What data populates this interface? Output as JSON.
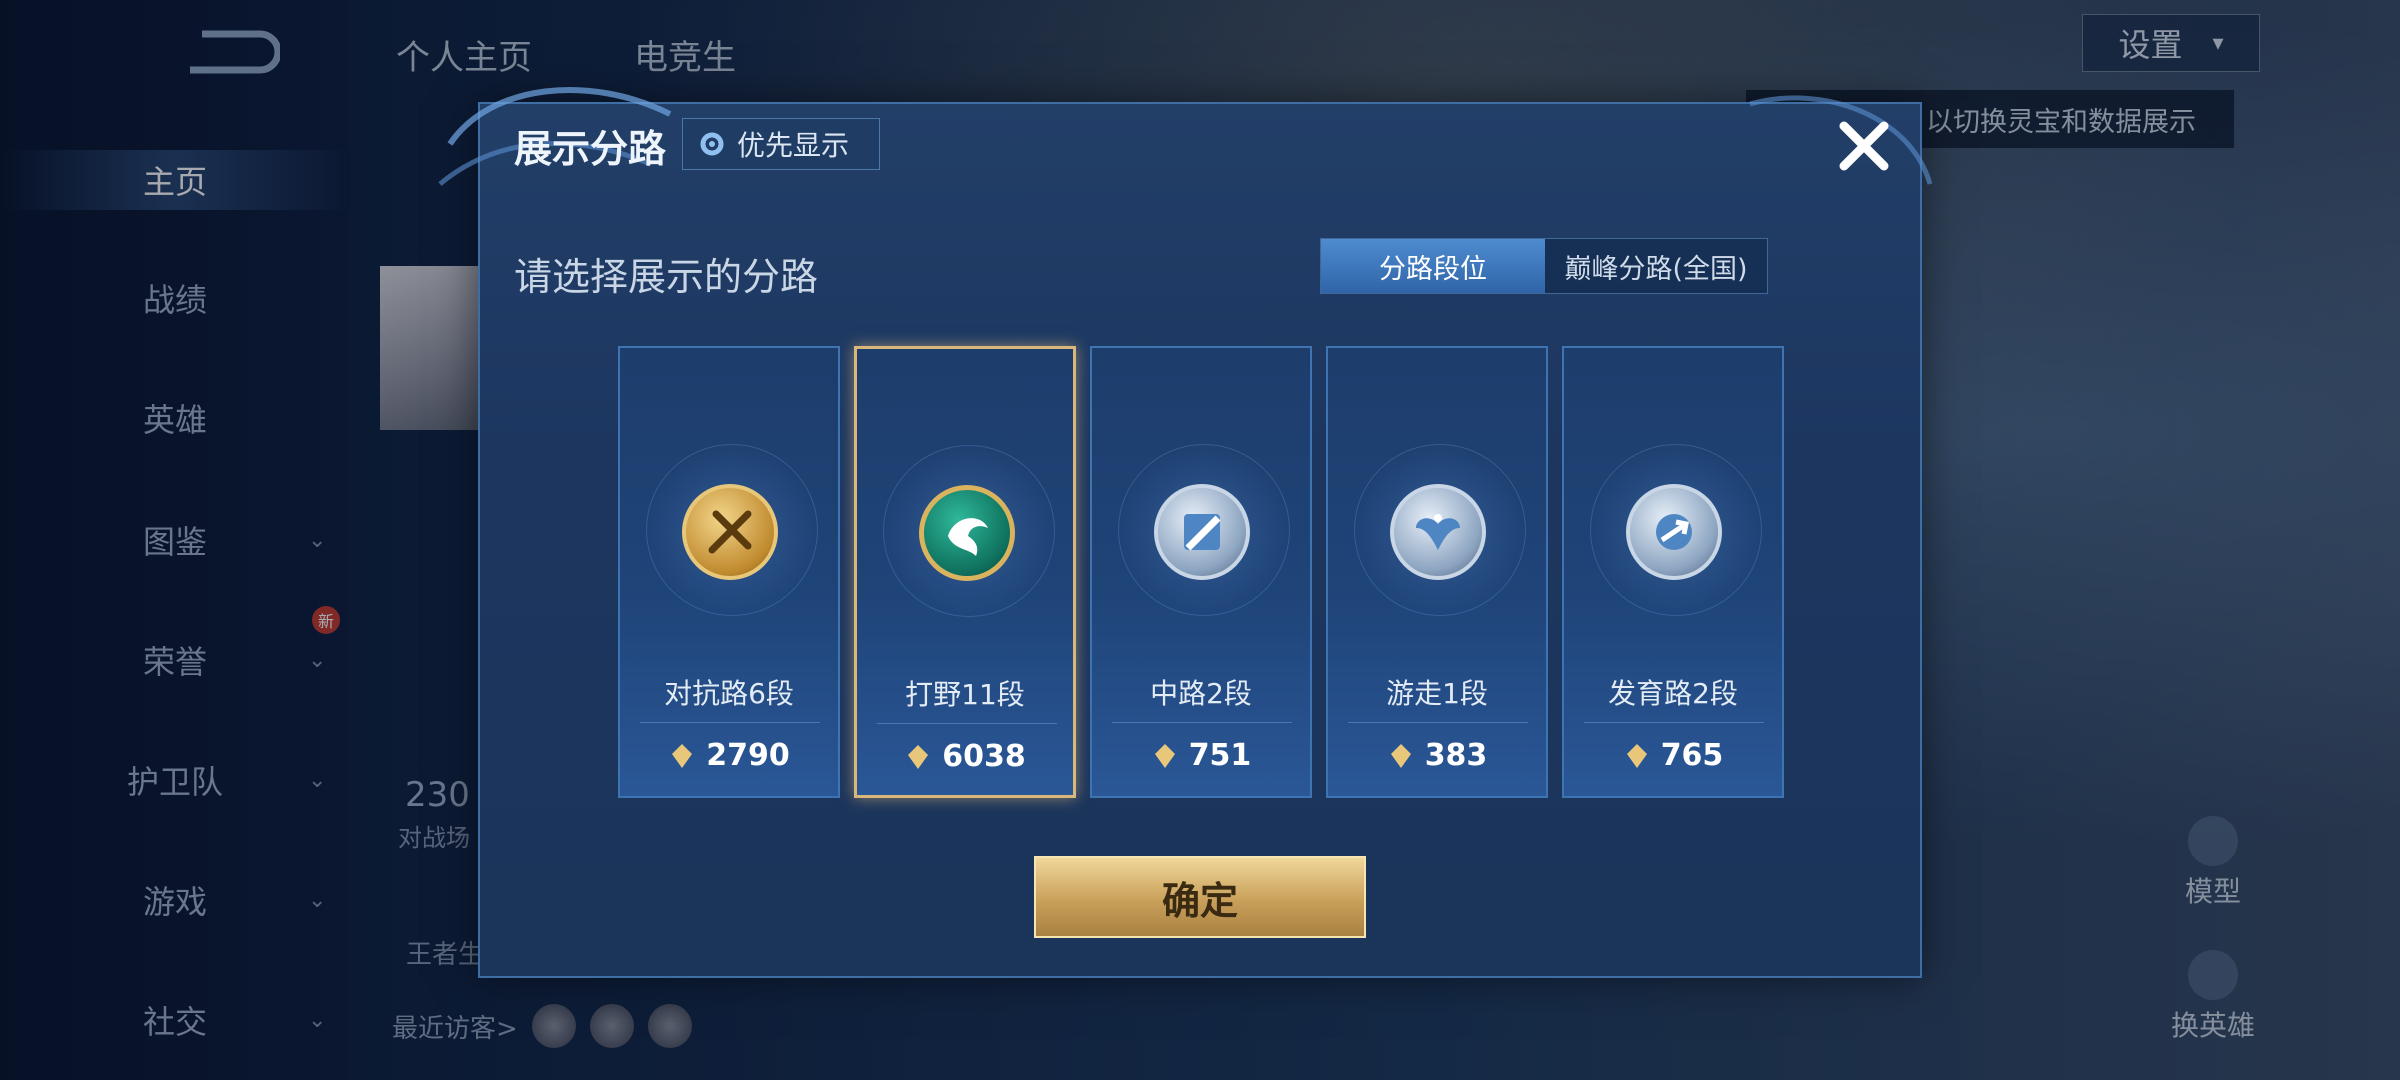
{
  "sidebar": {
    "items": [
      {
        "label": "主页",
        "active": true
      },
      {
        "label": "战绩"
      },
      {
        "label": "英雄"
      },
      {
        "label": "图鉴",
        "chevron": true
      },
      {
        "label": "荣誉",
        "chevron": true,
        "badge": "新"
      },
      {
        "label": "护卫队",
        "chevron": true
      },
      {
        "label": "游戏",
        "chevron": true
      },
      {
        "label": "社交",
        "chevron": true
      }
    ]
  },
  "background": {
    "tabs": [
      "个人主页",
      "电竞生"
    ],
    "settings_label": "设置",
    "tip_text": "以切换灵宝和数据展示",
    "stat_value": "230",
    "stat_sub": "对战场",
    "wz_label": "王者生",
    "recent_visitors_label": "最近访客>",
    "side_buttons": [
      "模型",
      "换英雄"
    ]
  },
  "modal": {
    "title": "展示分路",
    "priority_label": "优先显示",
    "prompt": "请选择展示的分路",
    "toggle": {
      "active": "分路段位",
      "inactive": "巅峰分路(全国)"
    },
    "confirm_label": "确定",
    "cards": [
      {
        "lane": "对抗路6段",
        "score": "2790",
        "badge": "gold",
        "icon": "sword-icon"
      },
      {
        "lane": "打野11段",
        "score": "6038",
        "badge": "jade",
        "icon": "dragon-icon",
        "selected": true
      },
      {
        "lane": "中路2段",
        "score": "751",
        "badge": "silver",
        "icon": "slash-icon"
      },
      {
        "lane": "游走1段",
        "score": "383",
        "badge": "silver",
        "icon": "wings-icon"
      },
      {
        "lane": "发育路2段",
        "score": "765",
        "badge": "silver",
        "icon": "arrow-icon"
      }
    ]
  },
  "colors": {
    "accent_gold": "#d9b77a",
    "modal_bg": "#1c3660",
    "toggle_active": "#3f7cc4"
  }
}
